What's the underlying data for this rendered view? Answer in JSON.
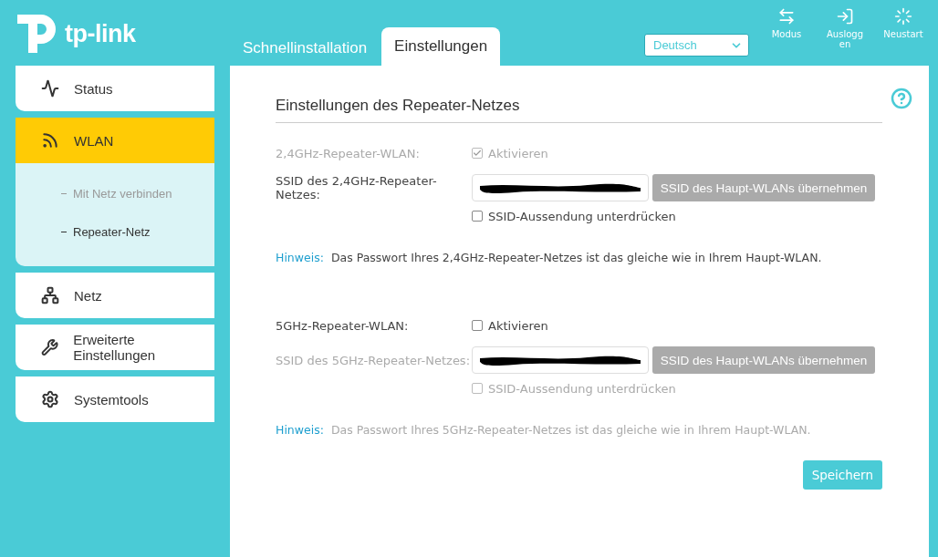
{
  "logo": {
    "text": "tp-link"
  },
  "tabs": [
    {
      "label": "Schnellinstallation",
      "selected": false
    },
    {
      "label": "Einstellungen",
      "selected": true
    }
  ],
  "language": {
    "value": "Deutsch"
  },
  "header_actions": [
    {
      "kind": "mode",
      "label": "Modus"
    },
    {
      "kind": "logout",
      "label": "Ausloggen"
    },
    {
      "kind": "reboot",
      "label": "Neustart"
    }
  ],
  "sidebar": {
    "items": [
      {
        "kind": "status",
        "label": "Status",
        "selected": false
      },
      {
        "kind": "wlan",
        "label": "WLAN",
        "selected": true,
        "children": [
          {
            "label": "Mit Netz verbinden",
            "selected": false
          },
          {
            "label": "Repeater-Netz",
            "selected": true
          }
        ]
      },
      {
        "kind": "network",
        "label": "Netz",
        "selected": false
      },
      {
        "kind": "advanced",
        "label": "Erweiterte Einstellungen",
        "selected": false
      },
      {
        "kind": "tools",
        "label": "Systemtools",
        "selected": false
      }
    ]
  },
  "page": {
    "title": "Einstellungen des Repeater-Netzes",
    "sections": [
      {
        "label": "2,4GHz-Repeater-WLAN:",
        "enable": {
          "label": "Aktivieren",
          "checked": true,
          "disabled": true
        },
        "ssid": {
          "label": "SSID des 2,4GHz-Repeater-Netzes:",
          "disabled": false
        },
        "copy_button": "SSID des Haupt-WLANs übernehmen",
        "hide": {
          "label": "SSID-Aussendung unterdrücken",
          "checked": false,
          "disabled": false
        },
        "note": {
          "prefix": "Hinweis:",
          "text": "Das Passwort Ihres 2,4GHz-Repeater-Netzes ist das gleiche wie in Ihrem Haupt-WLAN.",
          "disabled": false
        }
      },
      {
        "label": "5GHz-Repeater-WLAN:",
        "enable": {
          "label": "Aktivieren",
          "checked": false,
          "disabled": false
        },
        "ssid": {
          "label": "SSID des 5GHz-Repeater-Netzes:",
          "disabled": true
        },
        "copy_button": "SSID des Haupt-WLANs übernehmen",
        "hide": {
          "label": "SSID-Aussendung unterdrücken",
          "checked": false,
          "disabled": true
        },
        "note": {
          "prefix": "Hinweis:",
          "text": "Das Passwort Ihres 5GHz-Repeater-Netzes ist das gleiche wie in Ihrem Haupt-WLAN.",
          "disabled": true
        }
      }
    ],
    "save_button": "Speichern"
  }
}
